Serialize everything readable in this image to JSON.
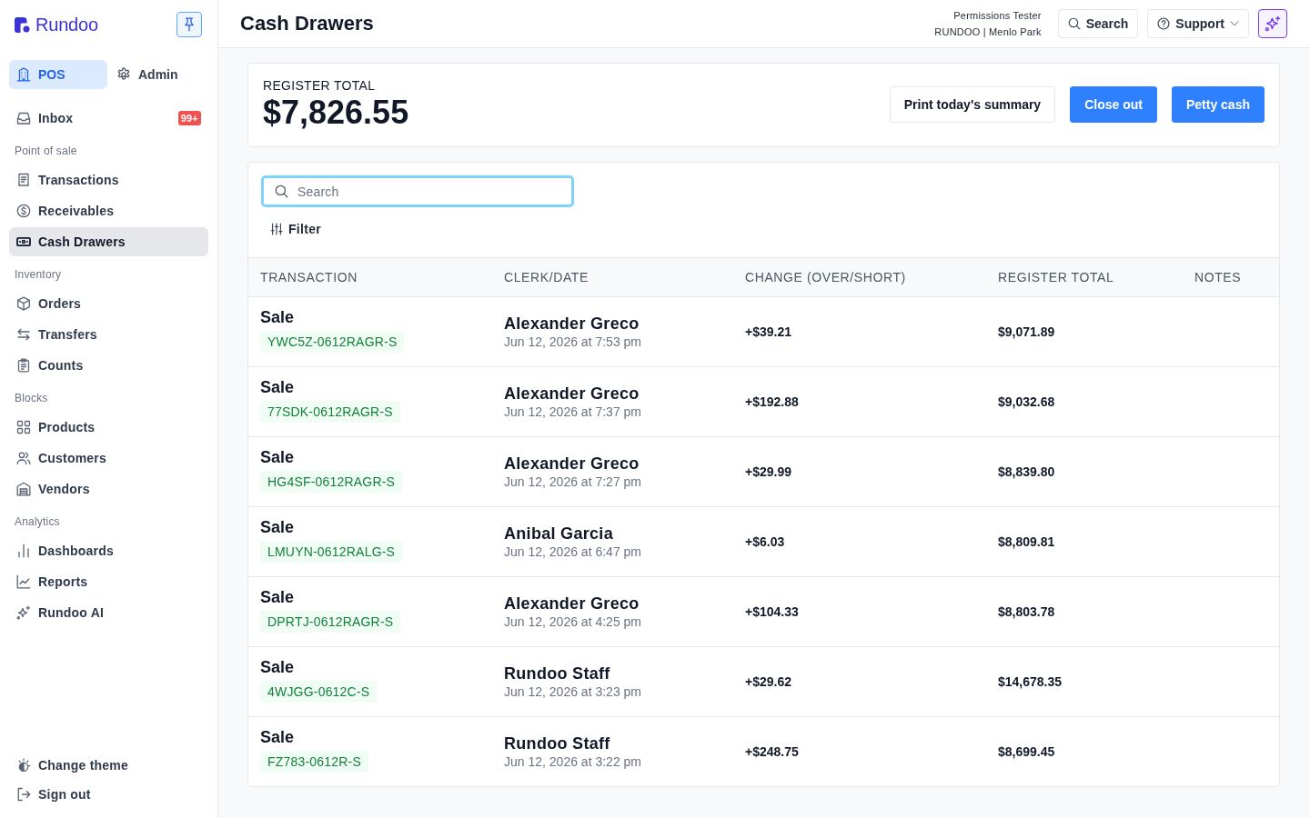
{
  "sidebar": {
    "logo": "Rundoo",
    "modes": [
      {
        "label": "POS",
        "selected": true
      },
      {
        "label": "Admin",
        "selected": false
      }
    ],
    "inbox": {
      "label": "Inbox",
      "badge": "99+",
      "selected": false
    },
    "sections": [
      {
        "title": "Point of sale",
        "items": [
          {
            "label": "Transactions",
            "selected": false
          },
          {
            "label": "Receivables",
            "selected": false
          },
          {
            "label": "Cash Drawers",
            "selected": true
          }
        ]
      },
      {
        "title": "Inventory",
        "items": [
          {
            "label": "Orders",
            "selected": false
          },
          {
            "label": "Transfers",
            "selected": false
          },
          {
            "label": "Counts",
            "selected": false
          }
        ]
      },
      {
        "title": "Blocks",
        "items": [
          {
            "label": "Products",
            "selected": false
          },
          {
            "label": "Customers",
            "selected": false
          },
          {
            "label": "Vendors",
            "selected": false
          }
        ]
      },
      {
        "title": "Analytics",
        "items": [
          {
            "label": "Dashboards",
            "selected": false
          },
          {
            "label": "Reports",
            "selected": false
          },
          {
            "label": "Rundoo AI",
            "selected": false
          }
        ]
      }
    ],
    "footer": [
      {
        "label": "Change theme"
      },
      {
        "label": "Sign out"
      }
    ]
  },
  "header": {
    "title": "Cash Drawers",
    "user": {
      "name": "Permissions Tester",
      "store": "RUNDOO | Menlo Park"
    },
    "search_button": "Search",
    "support_button": "Support"
  },
  "summary": {
    "label": "REGISTER TOTAL",
    "amount": "$7,826.55",
    "actions": [
      {
        "label": "Print today's summary",
        "kind": "secondary"
      },
      {
        "label": "Close out",
        "kind": "primary"
      },
      {
        "label": "Petty cash",
        "kind": "primary"
      }
    ]
  },
  "table": {
    "search": {
      "placeholder": "Search",
      "focused": true
    },
    "filter": "Filter",
    "columns": [
      "TRANSACTION",
      "CLERK/DATE",
      "CHANGE (OVER/SHORT)",
      "REGISTER TOTAL",
      "NOTES"
    ],
    "rows": [
      {
        "type": "Sale",
        "code": "YWC5Z-0612RAGR-S",
        "clerk": "Alexander Greco",
        "date": "Jun 12, 2026 at 7:53 pm",
        "change": "+$39.21",
        "register_total": "$9,071.89"
      },
      {
        "type": "Sale",
        "code": "77SDK-0612RAGR-S",
        "clerk": "Alexander Greco",
        "date": "Jun 12, 2026 at 7:37 pm",
        "change": "+$192.88",
        "register_total": "$9,032.68"
      },
      {
        "type": "Sale",
        "code": "HG4SF-0612RAGR-S",
        "clerk": "Alexander Greco",
        "date": "Jun 12, 2026 at 7:27 pm",
        "change": "+$29.99",
        "register_total": "$8,839.80"
      },
      {
        "type": "Sale",
        "code": "LMUYN-0612RALG-S",
        "clerk": "Anibal Garcia",
        "date": "Jun 12, 2026 at 6:47 pm",
        "change": "+$6.03",
        "register_total": "$8,809.81"
      },
      {
        "type": "Sale",
        "code": "DPRTJ-0612RAGR-S",
        "clerk": "Alexander Greco",
        "date": "Jun 12, 2026 at 4:25 pm",
        "change": "+$104.33",
        "register_total": "$8,803.78"
      },
      {
        "type": "Sale",
        "code": "4WJGG-0612C-S",
        "clerk": "Rundoo Staff",
        "date": "Jun 12, 2026 at 3:23 pm",
        "change": "+$29.62",
        "register_total": "$14,678.35"
      },
      {
        "type": "Sale",
        "code": "FZ783-0612R-S",
        "clerk": "Rundoo Staff",
        "date": "Jun 12, 2026 at 3:22 pm",
        "change": "+$248.75",
        "register_total": "$8,699.45"
      }
    ]
  }
}
